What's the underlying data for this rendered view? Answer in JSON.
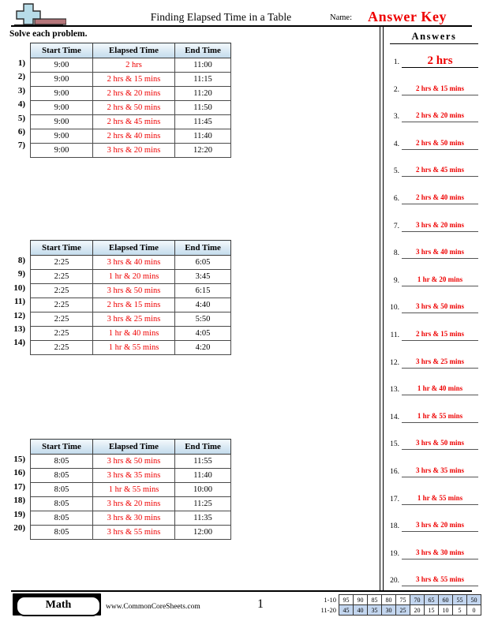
{
  "header": {
    "title": "Finding Elapsed Time in a Table",
    "name_label": "Name:",
    "answer_key": "Answer Key",
    "logo_icon": "plus-block-logo"
  },
  "instructions": "Solve each problem.",
  "columns": [
    "Start Time",
    "Elapsed Time",
    "End Time"
  ],
  "tables": [
    {
      "rows": [
        {
          "num": "1)",
          "start": "9:00",
          "elapsed": "2 hrs",
          "end": "11:00"
        },
        {
          "num": "2)",
          "start": "9:00",
          "elapsed": "2 hrs & 15 mins",
          "end": "11:15"
        },
        {
          "num": "3)",
          "start": "9:00",
          "elapsed": "2 hrs & 20 mins",
          "end": "11:20"
        },
        {
          "num": "4)",
          "start": "9:00",
          "elapsed": "2 hrs & 50 mins",
          "end": "11:50"
        },
        {
          "num": "5)",
          "start": "9:00",
          "elapsed": "2 hrs & 45 mins",
          "end": "11:45"
        },
        {
          "num": "6)",
          "start": "9:00",
          "elapsed": "2 hrs & 40 mins",
          "end": "11:40"
        },
        {
          "num": "7)",
          "start": "9:00",
          "elapsed": "3 hrs & 20 mins",
          "end": "12:20"
        }
      ]
    },
    {
      "rows": [
        {
          "num": "8)",
          "start": "2:25",
          "elapsed": "3 hrs & 40 mins",
          "end": "6:05"
        },
        {
          "num": "9)",
          "start": "2:25",
          "elapsed": "1 hr & 20 mins",
          "end": "3:45"
        },
        {
          "num": "10)",
          "start": "2:25",
          "elapsed": "3 hrs & 50 mins",
          "end": "6:15"
        },
        {
          "num": "11)",
          "start": "2:25",
          "elapsed": "2 hrs & 15 mins",
          "end": "4:40"
        },
        {
          "num": "12)",
          "start": "2:25",
          "elapsed": "3 hrs & 25 mins",
          "end": "5:50"
        },
        {
          "num": "13)",
          "start": "2:25",
          "elapsed": "1 hr & 40 mins",
          "end": "4:05"
        },
        {
          "num": "14)",
          "start": "2:25",
          "elapsed": "1 hr & 55 mins",
          "end": "4:20"
        }
      ]
    },
    {
      "rows": [
        {
          "num": "15)",
          "start": "8:05",
          "elapsed": "3 hrs & 50 mins",
          "end": "11:55"
        },
        {
          "num": "16)",
          "start": "8:05",
          "elapsed": "3 hrs & 35 mins",
          "end": "11:40"
        },
        {
          "num": "17)",
          "start": "8:05",
          "elapsed": "1 hr & 55 mins",
          "end": "10:00"
        },
        {
          "num": "18)",
          "start": "8:05",
          "elapsed": "3 hrs & 20 mins",
          "end": "11:25"
        },
        {
          "num": "19)",
          "start": "8:05",
          "elapsed": "3 hrs & 30 mins",
          "end": "11:35"
        },
        {
          "num": "20)",
          "start": "8:05",
          "elapsed": "3 hrs & 55 mins",
          "end": "12:00"
        }
      ]
    }
  ],
  "answers_panel": {
    "heading": "Answers",
    "items": [
      {
        "num": "1.",
        "value": "2 hrs"
      },
      {
        "num": "2.",
        "value": "2 hrs & 15 mins"
      },
      {
        "num": "3.",
        "value": "2 hrs & 20 mins"
      },
      {
        "num": "4.",
        "value": "2 hrs & 50 mins"
      },
      {
        "num": "5.",
        "value": "2 hrs & 45 mins"
      },
      {
        "num": "6.",
        "value": "2 hrs & 40 mins"
      },
      {
        "num": "7.",
        "value": "3 hrs & 20 mins"
      },
      {
        "num": "8.",
        "value": "3 hrs & 40 mins"
      },
      {
        "num": "9.",
        "value": "1 hr & 20 mins"
      },
      {
        "num": "10.",
        "value": "3 hrs & 50 mins"
      },
      {
        "num": "11.",
        "value": "2 hrs & 15 mins"
      },
      {
        "num": "12.",
        "value": "3 hrs & 25 mins"
      },
      {
        "num": "13.",
        "value": "1 hr & 40 mins"
      },
      {
        "num": "14.",
        "value": "1 hr & 55 mins"
      },
      {
        "num": "15.",
        "value": "3 hrs & 50 mins"
      },
      {
        "num": "16.",
        "value": "3 hrs & 35 mins"
      },
      {
        "num": "17.",
        "value": "1 hr & 55 mins"
      },
      {
        "num": "18.",
        "value": "3 hrs & 20 mins"
      },
      {
        "num": "19.",
        "value": "3 hrs & 30 mins"
      },
      {
        "num": "20.",
        "value": "3 hrs & 55 mins"
      }
    ]
  },
  "footer": {
    "subject": "Math",
    "url": "www.CommonCoreSheets.com",
    "page_number": "1",
    "score_table": {
      "rows": [
        {
          "label": "1-10",
          "cells": [
            {
              "v": "95",
              "hl": false
            },
            {
              "v": "90",
              "hl": false
            },
            {
              "v": "85",
              "hl": false
            },
            {
              "v": "80",
              "hl": false
            },
            {
              "v": "75",
              "hl": false
            },
            {
              "v": "70",
              "hl": true
            },
            {
              "v": "65",
              "hl": true
            },
            {
              "v": "60",
              "hl": true
            },
            {
              "v": "55",
              "hl": true
            },
            {
              "v": "50",
              "hl": true
            }
          ]
        },
        {
          "label": "11-20",
          "cells": [
            {
              "v": "45",
              "hl": true
            },
            {
              "v": "40",
              "hl": true
            },
            {
              "v": "35",
              "hl": true
            },
            {
              "v": "30",
              "hl": true
            },
            {
              "v": "25",
              "hl": true
            },
            {
              "v": "20",
              "hl": false
            },
            {
              "v": "15",
              "hl": false
            },
            {
              "v": "10",
              "hl": false
            },
            {
              "v": "5",
              "hl": false
            },
            {
              "v": "0",
              "hl": false
            }
          ]
        }
      ]
    }
  },
  "colors": {
    "answer_red": "#ee0000",
    "header_blue": "#c3dbec",
    "highlight_blue": "#c3d6ef",
    "logo_blue": "#b7dce8",
    "logo_red": "#b5767a"
  }
}
